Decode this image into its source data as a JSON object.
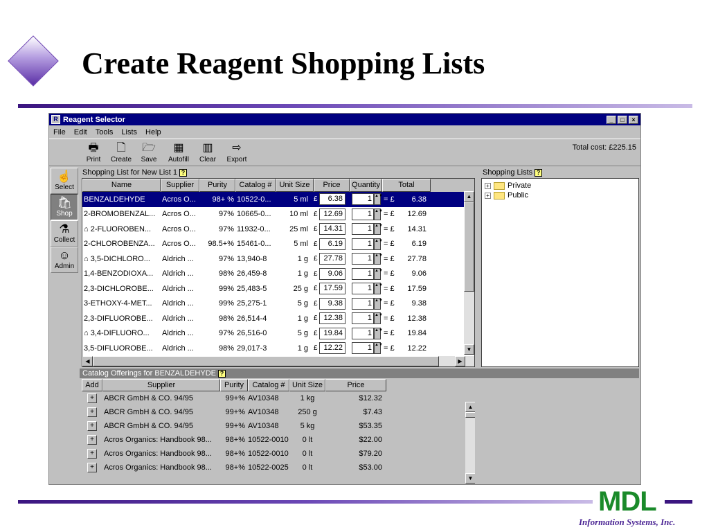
{
  "slide": {
    "title": "Create Reagent Shopping Lists",
    "logo": "MDL",
    "logo_sub": "Information Systems, Inc."
  },
  "window": {
    "title": "Reagent Selector",
    "min": "_",
    "max": "□",
    "close": "×"
  },
  "menu": [
    "File",
    "Edit",
    "Tools",
    "Lists",
    "Help"
  ],
  "toolbar": {
    "buttons": [
      "Print",
      "Create",
      "Save",
      "Autofill",
      "Clear",
      "Export"
    ],
    "total_cost": "Total cost: £225.15"
  },
  "nav": [
    "Select",
    "Shop",
    "Collect",
    "Admin"
  ],
  "shopping_list": {
    "header": "Shopping List for New List 1",
    "help": "?",
    "columns": [
      "Name",
      "Supplier",
      "Purity",
      "Catalog #",
      "Unit Size",
      "Price",
      "Quantity",
      "Total"
    ],
    "currency": "£",
    "equals": "= £",
    "rows": [
      {
        "name": "BENZALDEHYDE",
        "supplier": "Acros O...",
        "purity": "98+ %",
        "catalog": "10522-0...",
        "unit": "5 ml",
        "price": "6.38",
        "qty": "1",
        "total": "6.38",
        "home": false
      },
      {
        "name": "2-BROMOBENZAL...",
        "supplier": "Acros O...",
        "purity": "97%",
        "catalog": "10665-0...",
        "unit": "10 ml",
        "price": "12.69",
        "qty": "1",
        "total": "12.69",
        "home": false
      },
      {
        "name": "2-FLUOROBEN...",
        "supplier": "Acros O...",
        "purity": "97%",
        "catalog": "11932-0...",
        "unit": "25 ml",
        "price": "14.31",
        "qty": "1",
        "total": "14.31",
        "home": true
      },
      {
        "name": "2-CHLOROBENZA...",
        "supplier": "Acros O...",
        "purity": "98.5+%",
        "catalog": "15461-0...",
        "unit": "5 ml",
        "price": "6.19",
        "qty": "1",
        "total": "6.19",
        "home": false
      },
      {
        "name": "3,5-DICHLORO...",
        "supplier": "Aldrich ...",
        "purity": "97%",
        "catalog": "13,940-8",
        "unit": "1 g",
        "price": "27.78",
        "qty": "1",
        "total": "27.78",
        "home": true
      },
      {
        "name": "1,4-BENZODIOXA...",
        "supplier": "Aldrich ...",
        "purity": "98%",
        "catalog": "26,459-8",
        "unit": "1 g",
        "price": "9.06",
        "qty": "1",
        "total": "9.06",
        "home": false
      },
      {
        "name": "2,3-DICHLOROBE...",
        "supplier": "Aldrich ...",
        "purity": "99%",
        "catalog": "25,483-5",
        "unit": "25 g",
        "price": "17.59",
        "qty": "1",
        "total": "17.59",
        "home": false
      },
      {
        "name": "3-ETHOXY-4-MET...",
        "supplier": "Aldrich ...",
        "purity": "99%",
        "catalog": "25,275-1",
        "unit": "5 g",
        "price": "9.38",
        "qty": "1",
        "total": "9.38",
        "home": false
      },
      {
        "name": "2,3-DIFLUOROBE...",
        "supplier": "Aldrich ...",
        "purity": "98%",
        "catalog": "26,514-4",
        "unit": "1 g",
        "price": "12.38",
        "qty": "1",
        "total": "12.38",
        "home": false
      },
      {
        "name": "3,4-DIFLUORO...",
        "supplier": "Aldrich ...",
        "purity": "97%",
        "catalog": "26,516-0",
        "unit": "5 g",
        "price": "19.84",
        "qty": "1",
        "total": "19.84",
        "home": true
      },
      {
        "name": "3,5-DIFLUOROBE...",
        "supplier": "Aldrich ...",
        "purity": "98%",
        "catalog": "29,017-3",
        "unit": "1 g",
        "price": "12.22",
        "qty": "1",
        "total": "12.22",
        "home": false
      }
    ]
  },
  "shopping_lists": {
    "header": "Shopping Lists",
    "help": "?",
    "nodes": [
      "Private",
      "Public"
    ]
  },
  "catalog": {
    "header": "Catalog Offerings for BENZALDEHYDE",
    "help": "?",
    "columns": [
      "Add",
      "Supplier",
      "Purity",
      "Catalog #",
      "Unit Size",
      "Price"
    ],
    "rows": [
      {
        "supplier": "ABCR GmbH & CO. 94/95",
        "purity": "99+%",
        "catalog": "AV10348",
        "unit": "1 kg",
        "price": "$12.32"
      },
      {
        "supplier": "ABCR GmbH & CO. 94/95",
        "purity": "99+%",
        "catalog": "AV10348",
        "unit": "250 g",
        "price": "$7.43"
      },
      {
        "supplier": "ABCR GmbH & CO. 94/95",
        "purity": "99+%",
        "catalog": "AV10348",
        "unit": "5 kg",
        "price": "$53.35"
      },
      {
        "supplier": "Acros Organics: Handbook 98...",
        "purity": "98+%",
        "catalog": "10522-0010",
        "unit": "0 lt",
        "price": "$22.00"
      },
      {
        "supplier": "Acros Organics: Handbook 98...",
        "purity": "98+%",
        "catalog": "10522-0010",
        "unit": "0 lt",
        "price": "$79.20"
      },
      {
        "supplier": "Acros Organics: Handbook 98...",
        "purity": "98+%",
        "catalog": "10522-0025",
        "unit": "0 lt",
        "price": "$53.00"
      }
    ]
  }
}
